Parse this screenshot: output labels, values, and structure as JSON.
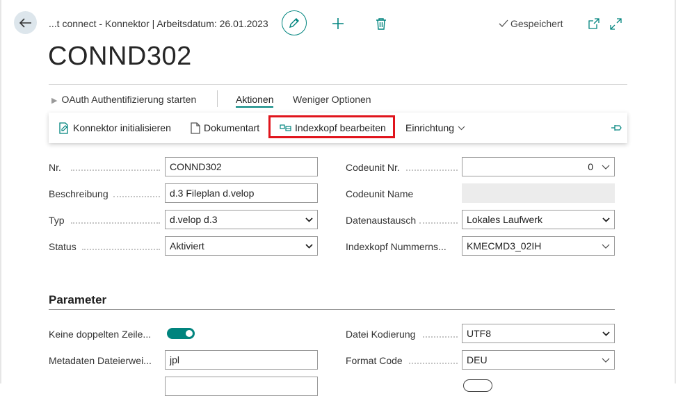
{
  "header": {
    "breadcrumb": "...t connect - Konnektor | Arbeitsdatum: 26.01.2023",
    "saved_label": "Gespeichert",
    "title": "CONND302"
  },
  "action_bar": {
    "oauth_label": "OAuth Authentifizierung starten",
    "actions_label": "Aktionen",
    "fewer_options_label": "Weniger Optionen"
  },
  "ribbon": {
    "init_label": "Konnektor initialisieren",
    "doctype_label": "Dokumentart",
    "index_header_label": "Indexkopf bearbeiten",
    "setup_label": "Einrichtung"
  },
  "general": {
    "no_label": "Nr.",
    "no_value": "CONND302",
    "description_label": "Beschreibung",
    "description_value": "d.3 Fileplan d.velop",
    "type_label": "Typ",
    "type_value": "d.velop d.3",
    "status_label": "Status",
    "status_value": "Aktiviert",
    "codeunit_no_label": "Codeunit Nr.",
    "codeunit_no_value": "0",
    "codeunit_name_label": "Codeunit Name",
    "data_exchange_label": "Datenaustausch",
    "data_exchange_value": "Lokales Laufwerk",
    "index_series_label": "Indexkopf Nummerns...",
    "index_series_value": "KMECMD3_02IH"
  },
  "parameter": {
    "section_title": "Parameter",
    "no_duplicate_label": "Keine doppelten Zeile...",
    "no_duplicate_enabled": true,
    "metadata_ext_label": "Metadaten Dateierwei...",
    "metadata_ext_value": "jpl",
    "encoding_label": "Datei Kodierung",
    "encoding_value": "UTF8",
    "format_code_label": "Format Code",
    "format_code_value": "DEU"
  },
  "colors": {
    "accent": "#00847e",
    "highlight": "#e0141c"
  }
}
